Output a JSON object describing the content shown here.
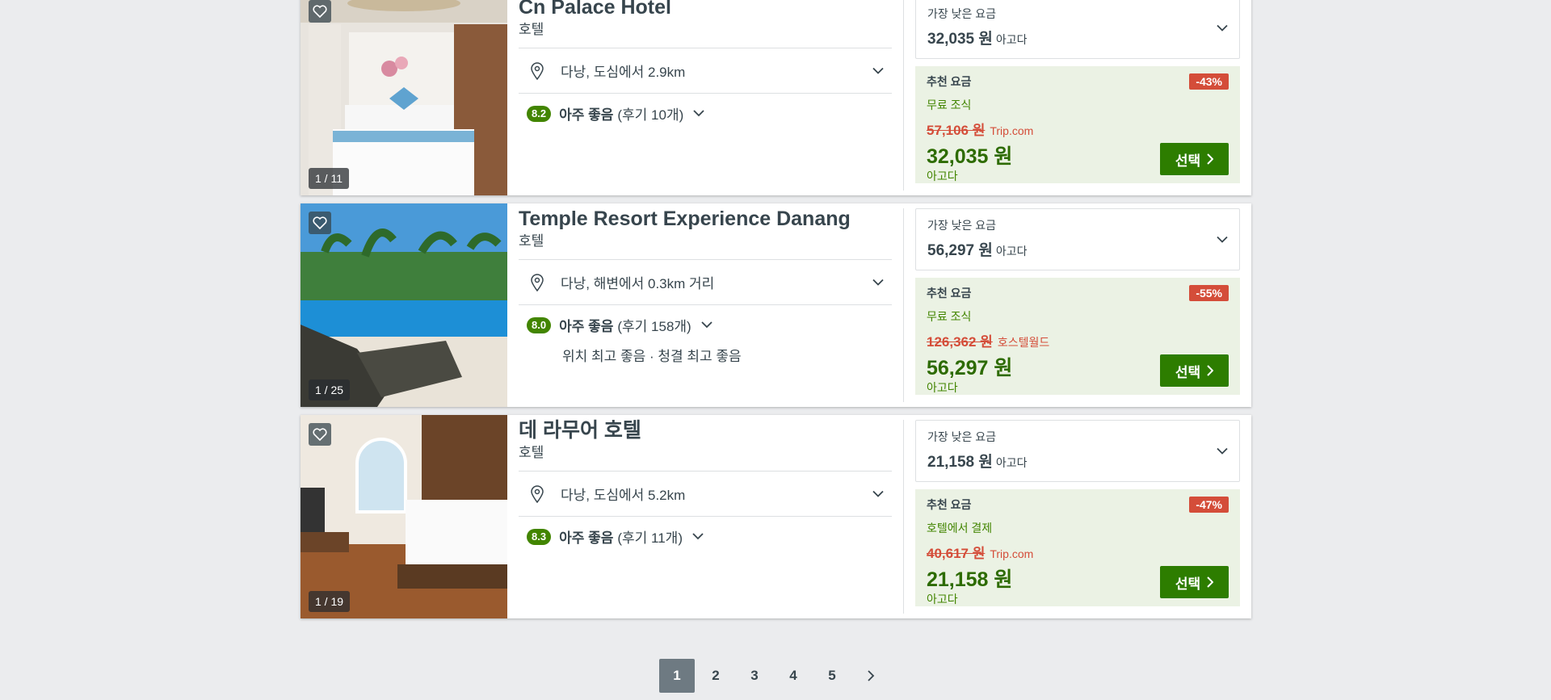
{
  "hotels": [
    {
      "name": "Cn Palace Hotel",
      "type": "호텔",
      "location": "다낭, 도심에서 2.9km",
      "score": "8.2",
      "rating_label": "아주 좋음",
      "rating_count": "(후기 10개)",
      "highlights": "",
      "photo_counter": "1 / 11",
      "lowest_label": "가장 낮은 요금",
      "lowest_amount": "32,035 원",
      "lowest_source": "아고다",
      "rec_label": "추천 요금",
      "discount": "-43%",
      "perk": "무료 조식",
      "old_price": "57,106 원",
      "old_source": "Trip.com",
      "price": "32,035 원",
      "price_source": "아고다",
      "select_label": "선택"
    },
    {
      "name": "Temple Resort Experience Danang",
      "type": "호텔",
      "location": "다낭, 해변에서 0.3km 거리",
      "score": "8.0",
      "rating_label": "아주 좋음",
      "rating_count": "(후기 158개)",
      "highlights": "위치 최고 좋음 · 청결 최고 좋음",
      "photo_counter": "1 / 25",
      "lowest_label": "가장 낮은 요금",
      "lowest_amount": "56,297 원",
      "lowest_source": "아고다",
      "rec_label": "추천 요금",
      "discount": "-55%",
      "perk": "무료 조식",
      "old_price": "126,362 원",
      "old_source": "호스텔월드",
      "price": "56,297 원",
      "price_source": "아고다",
      "select_label": "선택"
    },
    {
      "name": "데 라무어 호텔",
      "type": "호텔",
      "location": "다낭, 도심에서 5.2km",
      "score": "8.3",
      "rating_label": "아주 좋음",
      "rating_count": "(후기 11개)",
      "highlights": "",
      "photo_counter": "1 / 19",
      "lowest_label": "가장 낮은 요금",
      "lowest_amount": "21,158 원",
      "lowest_source": "아고다",
      "rec_label": "추천 요금",
      "discount": "-47%",
      "perk": "호텔에서 결제",
      "old_price": "40,617 원",
      "old_source": "Trip.com",
      "price": "21,158 원",
      "price_source": "아고다",
      "select_label": "선택"
    }
  ],
  "pagination": {
    "pages": [
      "1",
      "2",
      "3",
      "4",
      "5"
    ],
    "active": "1"
  },
  "icons": {
    "favorite": "heart-icon",
    "location": "map-pin-icon",
    "expand": "chevron-down-icon",
    "select": "chevron-right-icon",
    "next": "chevron-right-icon"
  },
  "colors": {
    "green_badge": "#428500",
    "select_button": "#2d7d00",
    "discount": "#d44d39",
    "recommended_bg": "#ebf2e4",
    "active_page": "#6e7a82"
  }
}
